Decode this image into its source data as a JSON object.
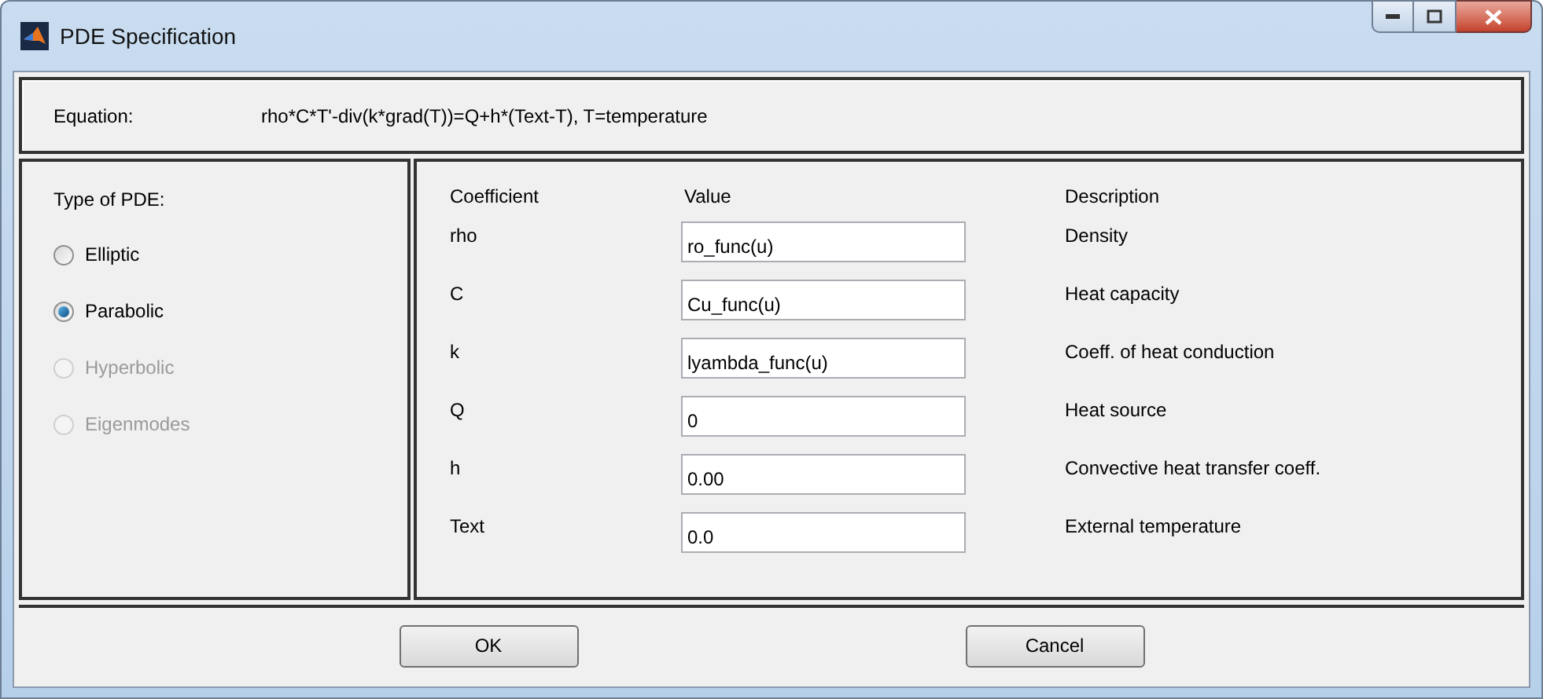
{
  "window": {
    "title": "PDE Specification"
  },
  "equation": {
    "label": "Equation:",
    "text": "rho*C*T'-div(k*grad(T))=Q+h*(Text-T), T=temperature"
  },
  "pde_type": {
    "label": "Type of PDE:",
    "options": [
      {
        "label": "Elliptic",
        "selected": false,
        "disabled": false
      },
      {
        "label": "Parabolic",
        "selected": true,
        "disabled": false
      },
      {
        "label": "Hyperbolic",
        "selected": false,
        "disabled": true
      },
      {
        "label": "Eigenmodes",
        "selected": false,
        "disabled": true
      }
    ]
  },
  "coefficients": {
    "columns": [
      "Coefficient",
      "Value",
      "Description"
    ],
    "rows": [
      {
        "coefficient": "rho",
        "value": "ro_func(u)",
        "description": "Density"
      },
      {
        "coefficient": "C",
        "value": "Cu_func(u)",
        "description": "Heat capacity"
      },
      {
        "coefficient": "k",
        "value": "lyambda_func(u)",
        "description": "Coeff. of heat conduction"
      },
      {
        "coefficient": "Q",
        "value": "0",
        "description": "Heat source"
      },
      {
        "coefficient": "h",
        "value": "0.00",
        "description": "Convective heat transfer coeff."
      },
      {
        "coefficient": "Text",
        "value": "0.0",
        "description": "External temperature"
      }
    ]
  },
  "buttons": [
    "OK",
    "Cancel"
  ]
}
